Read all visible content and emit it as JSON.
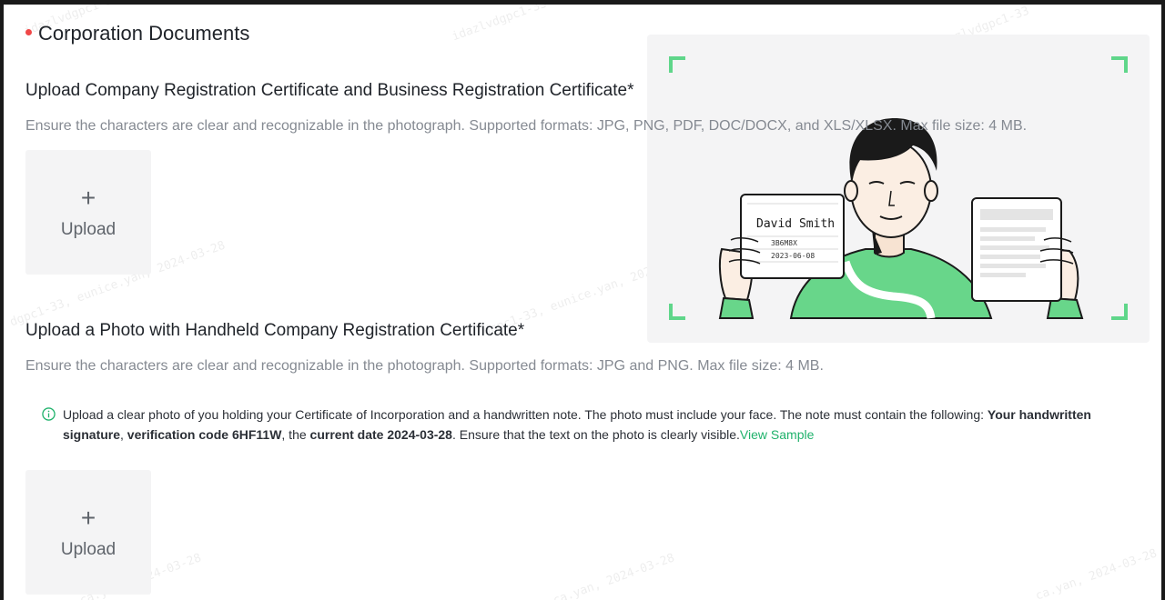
{
  "section": {
    "title": "Corporation Documents"
  },
  "upload1": {
    "heading": "Upload Company Registration Certificate and Business Registration Certificate*",
    "description": "Ensure the characters are clear and recognizable in the photograph. Supported formats: JPG, PNG, PDF, DOC/DOCX, and XLS/XLSX. Max file size: 4 MB.",
    "plus": "+",
    "button_label": "Upload"
  },
  "upload2": {
    "heading": "Upload a Photo with Handheld Company Registration Certificate*",
    "description": "Ensure the characters are clear and recognizable in the photograph. Supported formats: JPG and PNG. Max file size: 4 MB.",
    "plus": "+",
    "button_label": "Upload"
  },
  "notice": {
    "icon": "info-icon",
    "text_1": "Upload a clear photo of you holding your Certificate of Incorporation and a handwritten note. The photo must include your face. The note must contain the following: ",
    "bold_1": "Your handwritten signature",
    "text_2": ", ",
    "bold_2": "verification code 6HF11W",
    "text_3": ", the ",
    "bold_3": "current date 2024-03-28",
    "text_4": ". Ensure that the text on the photo is clearly visible.",
    "link": "View Sample"
  },
  "sample": {
    "note_name": "David Smith",
    "note_code": "3B6M8X",
    "note_date": "2023-06-08"
  },
  "watermark": {
    "text_a": "idazlvdgpc1-33",
    "text_b": "ca.yan, 2024-03-28",
    "text_c": "dgpc1-33, eunice.yan, 2024-03-28"
  },
  "colors": {
    "accent": "#20b26c",
    "required_dot": "#f04848",
    "frame_corner": "#5fd68a",
    "shirt": "#68d68a"
  }
}
